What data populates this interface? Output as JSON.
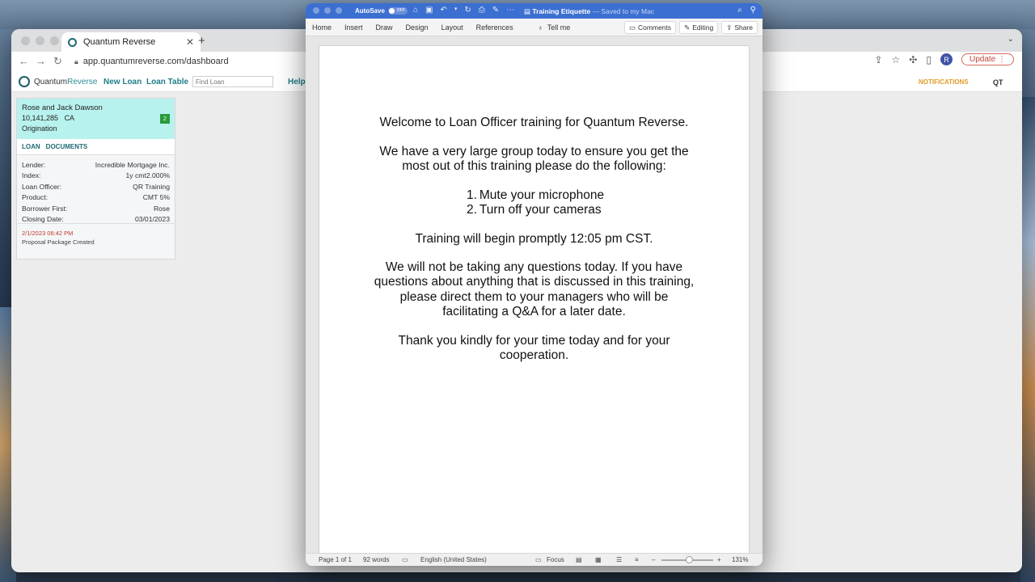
{
  "browser": {
    "tab_title": "Quantum Reverse",
    "url": "app.quantumreverse.com/dashboard",
    "update_label": "Update",
    "avatar_initial": "R"
  },
  "app": {
    "logo_part1": "Quantum",
    "logo_part2": "Reverse",
    "nav": {
      "new_loan": "New Loan",
      "loan_table": "Loan Table",
      "help": "Help"
    },
    "find_loan_placeholder": "Find Loan",
    "notifications": "NOTIFICATIONS",
    "user_initials": "QT",
    "loan_card": {
      "name": "Rose and Jack Dawson",
      "loan_number": "10,141,285",
      "state": "CA",
      "stage": "Origination",
      "badge": "2",
      "tabs": [
        "LOAN",
        "DOCUMENTS"
      ],
      "rows": [
        {
          "label": "Lender:",
          "value": "Incredible Mortgage Inc."
        },
        {
          "label": "Index:",
          "value": "1y cmt2.000%"
        },
        {
          "label": "Loan Officer:",
          "value": "QR Training"
        },
        {
          "label": "Product:",
          "value": "CMT 5%"
        },
        {
          "label": "Borrower First:",
          "value": "Rose"
        },
        {
          "label": "Closing Date:",
          "value": "03/01/2023"
        }
      ],
      "event_time": "2/1/2023 06:42 PM",
      "event_text": "Proposal Package Created"
    }
  },
  "word": {
    "autosave_label": "AutoSave",
    "autosave_state": "OFF",
    "doc_title": "Training Etiquette",
    "saved_status": "— Saved to my Mac",
    "ribbon_tabs": [
      "Home",
      "Insert",
      "Draw",
      "Design",
      "Layout",
      "References"
    ],
    "tell_me": "Tell me",
    "comments_label": "Comments",
    "editing_label": "Editing",
    "share_label": "Share",
    "document": {
      "p1": "Welcome to Loan Officer training for Quantum Reverse.",
      "p2a": "We have a very large group today to ensure you get the",
      "p2b": "most out of this training please do the following:",
      "list": [
        {
          "num": "1.",
          "text": "Mute your microphone"
        },
        {
          "num": "2.",
          "text": "Turn off your cameras"
        }
      ],
      "p3": "Training will begin promptly 12:05 pm CST.",
      "p4a": "We will not be taking any questions today.  If you have",
      "p4b": "questions about anything that is discussed in this training,",
      "p4c": "please direct them to your managers who will be",
      "p4d": "facilitating a Q&A for a later date.",
      "p5a": "Thank you kindly for your time today and for your",
      "p5b": "cooperation."
    },
    "status": {
      "page": "Page 1 of 1",
      "words": "92 words",
      "language": "English (United States)",
      "focus": "Focus",
      "zoom": "131%"
    }
  }
}
